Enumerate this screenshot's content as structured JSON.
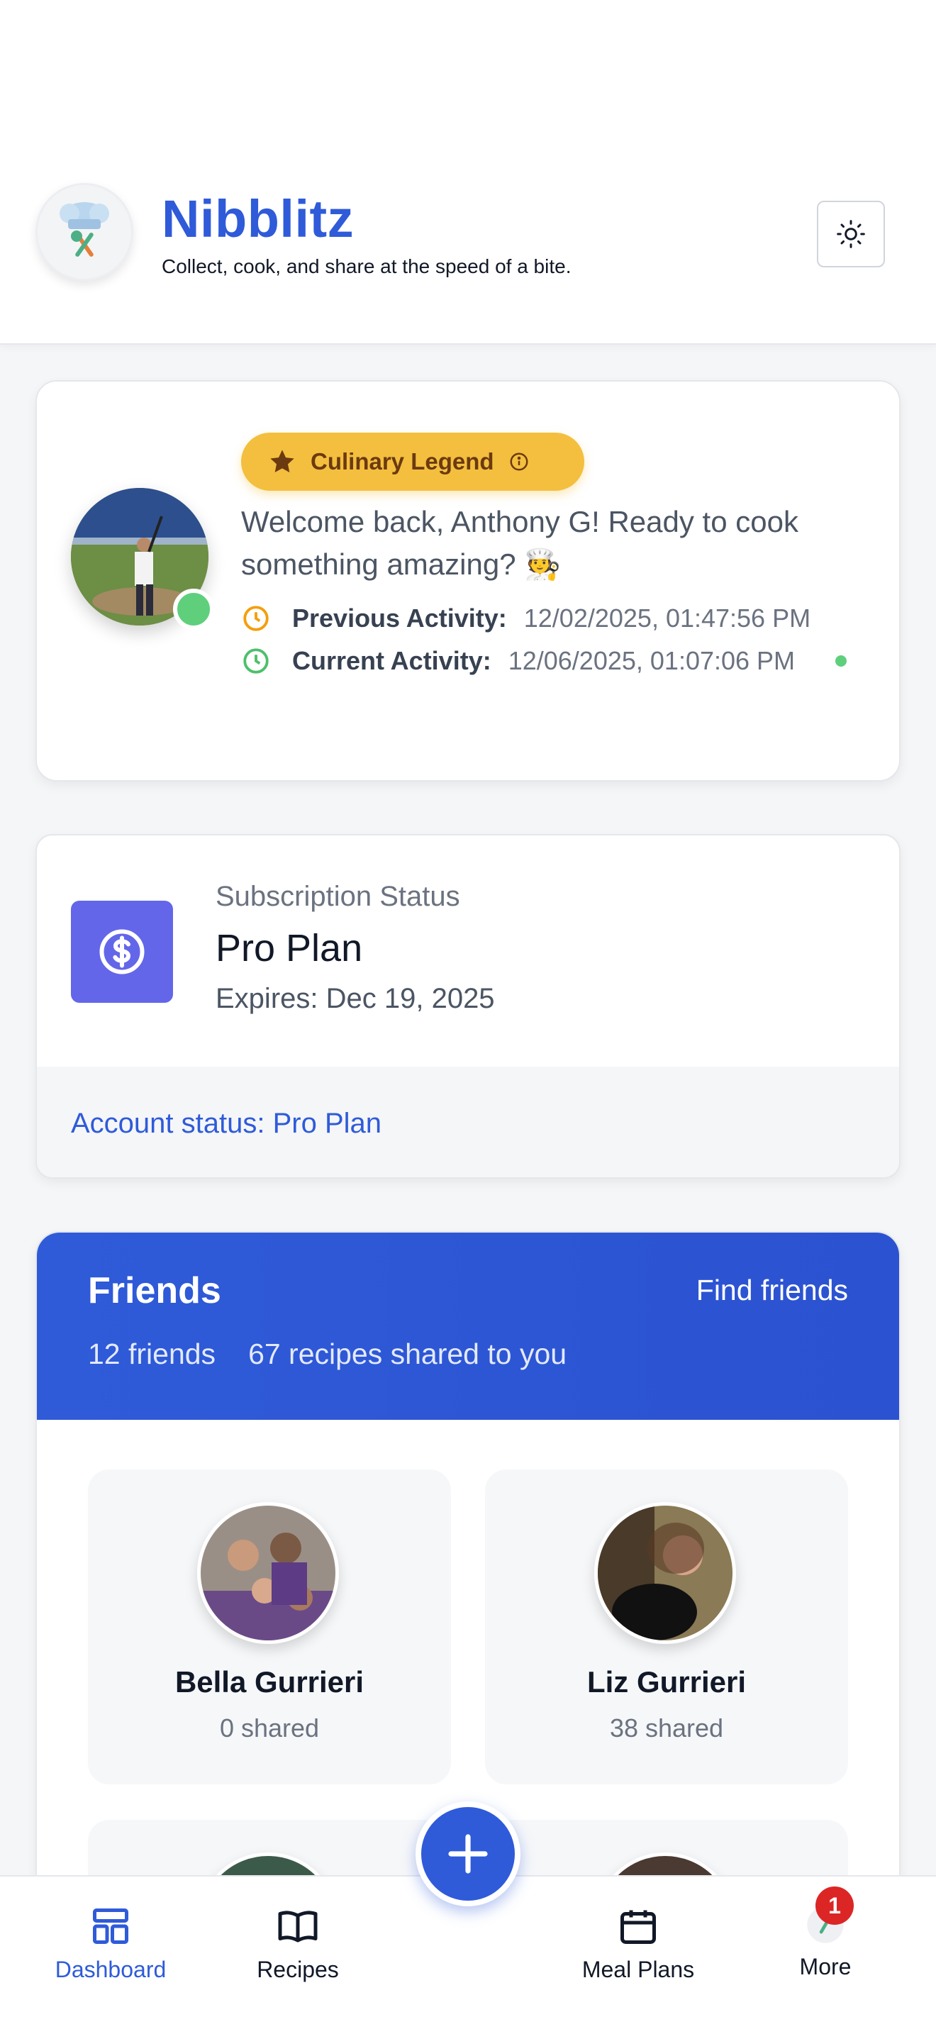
{
  "header": {
    "title": "Nibblitz",
    "tagline": "Collect, cook, and share at the speed of a bite."
  },
  "welcome": {
    "badge": "Culinary Legend",
    "message": "Welcome back, Anthony G! Ready to cook something amazing? 🧑‍🍳",
    "previous_label": "Previous Activity:",
    "previous_value": "12/02/2025, 01:47:56 PM",
    "current_label": "Current Activity:",
    "current_value": "12/06/2025, 01:07:06 PM"
  },
  "subscription": {
    "label": "Subscription Status",
    "plan": "Pro Plan",
    "expires": "Expires: Dec 19, 2025",
    "account_status": "Account status: Pro Plan"
  },
  "friends": {
    "title": "Friends",
    "find_label": "Find friends",
    "count": "12 friends",
    "shared": "67 recipes shared to you",
    "list": [
      {
        "name": "Bella Gurrieri",
        "shared": "0 shared"
      },
      {
        "name": "Liz Gurrieri",
        "shared": "38 shared"
      }
    ]
  },
  "nav": {
    "dashboard": "Dashboard",
    "recipes": "Recipes",
    "meal_plans": "Meal Plans",
    "more": "More",
    "more_badge": "1"
  },
  "colors": {
    "brand": "#2f5bd9",
    "badge": "#f4bf3e",
    "online": "#5fcf7c",
    "subscription_icon": "#6466e9",
    "notification": "#dc2626"
  }
}
